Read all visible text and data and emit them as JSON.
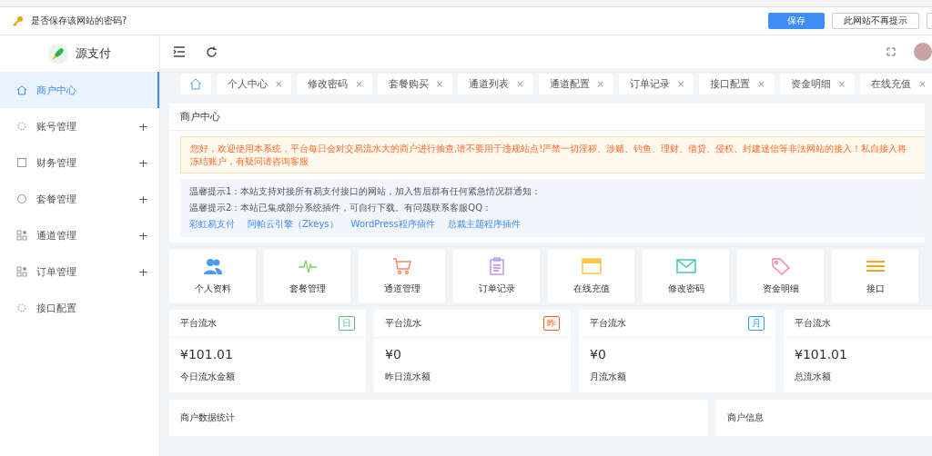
{
  "password_bar": {
    "prompt": "是否保存该网站的密码?",
    "buttons": [
      {
        "label": "保存",
        "primary": true
      },
      {
        "label": "此网站不再提示",
        "primary": false
      }
    ]
  },
  "sidebar": {
    "brand": "源支付",
    "items": [
      {
        "label": "商户中心",
        "selected": true
      },
      {
        "label": "账号管理",
        "selected": false,
        "expand_sign": "+"
      },
      {
        "label": "财务管理",
        "selected": false,
        "expand_sign": "+"
      },
      {
        "label": "套餐管理",
        "selected": false,
        "expand_sign": "+"
      },
      {
        "label": "通道管理",
        "selected": false,
        "expand_sign": "+"
      },
      {
        "label": "订单管理",
        "selected": false,
        "expand_sign": "+"
      },
      {
        "label": "接口配置",
        "selected": false
      }
    ]
  },
  "tabs": [
    {
      "label": "个人中心",
      "close": "×",
      "selected": false
    },
    {
      "label": "修改密码",
      "close": "×",
      "selected": false
    },
    {
      "label": "套餐购买",
      "close": "×",
      "selected": false
    },
    {
      "label": "通道列表",
      "close": "×",
      "selected": false
    },
    {
      "label": "通道配置",
      "close": "×",
      "selected": false
    },
    {
      "label": "订单记录",
      "close": "×",
      "selected": false
    },
    {
      "label": "接口配置",
      "close": "×",
      "selected": false
    },
    {
      "label": "资金明细",
      "close": "×",
      "selected": false
    },
    {
      "label": "在线充值",
      "close": "×",
      "selected": false
    }
  ],
  "home_tab": {
    "selected": true
  },
  "merchant_center": {
    "title": "商户中心",
    "warning": "您好，欢迎使用本系统，平台每日会对交易流水大的商户进行抽查,请不要用于违规站点!严禁一切淫秽、涉赌、钓鱼、理财、借贷、侵权、封建迷信等非法网站的接入！私自接入将冻结账户，有疑问请咨询客服",
    "tips": [
      "温馨提示1：本站支持对接所有易支付接口的网站，加入售后群有任何紧急情况群通知：",
      "温馨提示2：本站已集成部分系统插件，可自行下载。有问题联系客服QQ："
    ],
    "links": [
      "彩虹易支付",
      "阿帕云引擎（Zkeys）",
      "WordPress程序插件",
      "总裁主题程序插件"
    ]
  },
  "quick_links": [
    "个人资料",
    "套餐管理",
    "通道管理",
    "订单记录",
    "在线充值",
    "修改密码",
    "资金明细",
    "接口"
  ],
  "stats": [
    {
      "title": "平台流水",
      "badge": "日",
      "color": "#5fb878",
      "amount": "¥101.01",
      "caption": "今日流水金额"
    },
    {
      "title": "平台流水",
      "badge": "昨",
      "color": "#ff5722",
      "amount": "¥0",
      "caption": "昨日流水额"
    },
    {
      "title": "平台流水",
      "badge": "月",
      "color": "#1e9fff",
      "amount": "¥0",
      "caption": "月流水额"
    },
    {
      "title": "平台流水",
      "amount": "¥101.01",
      "caption": "总流水额"
    }
  ],
  "bottom_cards": [
    "商户数据统计",
    "商户信息"
  ]
}
